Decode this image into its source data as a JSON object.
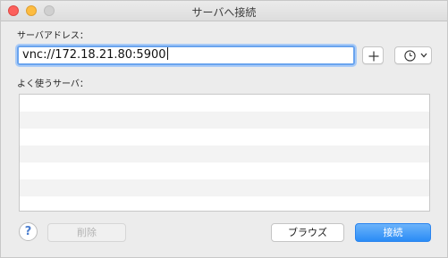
{
  "window": {
    "title": "サーバへ接続"
  },
  "server_address": {
    "label": "サーバアドレス：",
    "value": "vnc://172.18.21.80:5900"
  },
  "favorites": {
    "label": "よく使うサーバ：",
    "items": []
  },
  "buttons": {
    "help": "?",
    "delete": "削除",
    "browse": "ブラウズ",
    "connect": "接続"
  },
  "colors": {
    "accent": "#2a8cf6",
    "focus_ring": "#6aa4ee"
  }
}
